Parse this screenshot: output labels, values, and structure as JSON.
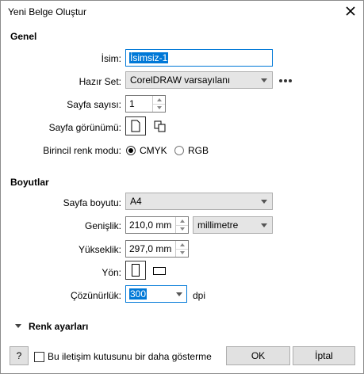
{
  "window": {
    "title": "Yeni Belge Oluştur"
  },
  "general": {
    "section_title": "Genel",
    "name_label": "İsim:",
    "name_value": "İsimsiz-1",
    "preset_label": "Hazır Set:",
    "preset_value": "CorelDRAW varsayılanı",
    "pages_label": "Sayfa sayısı:",
    "pages_value": "1",
    "page_view_label": "Sayfa görünümü:",
    "color_mode_label": "Birincil renk modu:",
    "color_mode_cmyk": "CMYK",
    "color_mode_rgb": "RGB",
    "color_mode_selected": "CMYK"
  },
  "dimensions": {
    "section_title": "Boyutlar",
    "page_size_label": "Sayfa boyutu:",
    "page_size_value": "A4",
    "width_label": "Genişlik:",
    "width_value": "210,0 mm",
    "unit_value": "millimetre",
    "height_label": "Yükseklik:",
    "height_value": "297,0 mm",
    "orientation_label": "Yön:",
    "resolution_label": "Çözünürlük:",
    "resolution_value": "300",
    "resolution_unit": "dpi"
  },
  "color_settings": {
    "label": "Renk ayarları"
  },
  "footer": {
    "help_label": "?",
    "dont_show_label": "Bu iletişim kutusunu bir daha gösterme",
    "ok_label": "OK",
    "cancel_label": "İptal"
  },
  "colors": {
    "selection": "#0078d7",
    "focus_border": "#0078d7"
  },
  "icons": {
    "close": "close-icon",
    "more": "more-options-icon",
    "single_page": "single-page-view-icon",
    "multi_page": "multi-page-view-icon",
    "portrait": "portrait-orientation-icon",
    "landscape": "landscape-orientation-icon",
    "expand": "expand-triangle-icon"
  }
}
